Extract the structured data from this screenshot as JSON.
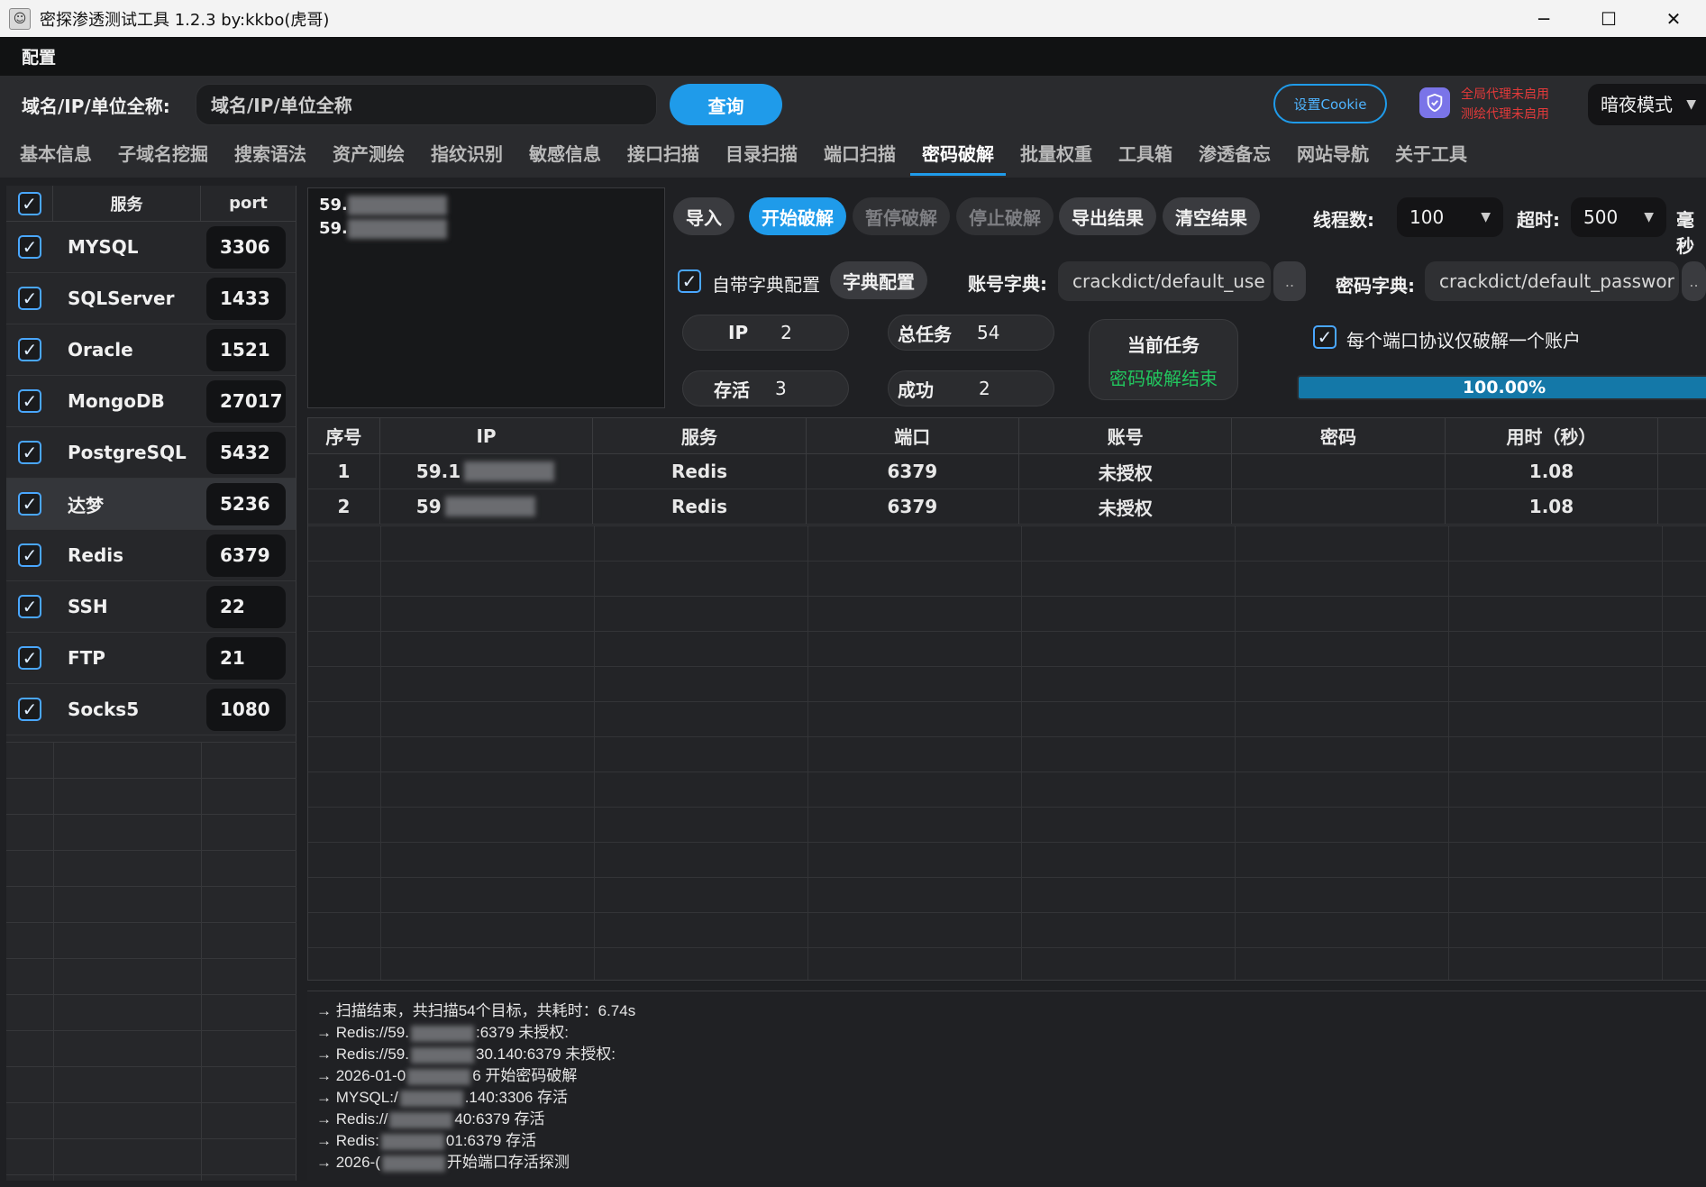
{
  "window": {
    "title": "密探渗透测试工具 1.2.3 by:kkbo(虎哥)",
    "minimize": "─",
    "maximize": "☐",
    "close": "✕"
  },
  "menu": {
    "config": "配置"
  },
  "search": {
    "label": "域名/IP/单位全称:",
    "placeholder": "域名/IP/单位全称",
    "query_button": "查询",
    "cookie_button": "设置Cookie",
    "proxy_global": "全局代理未启用",
    "proxy_test": "测绘代理未启用",
    "mode": "暗夜模式"
  },
  "tabs": [
    "基本信息",
    "子域名挖掘",
    "搜索语法",
    "资产测绘",
    "指纹识别",
    "敏感信息",
    "接口扫描",
    "目录扫描",
    "端口扫描",
    "密码破解",
    "批量权重",
    "工具箱",
    "渗透备忘",
    "网站导航",
    "关于工具"
  ],
  "active_tab": "密码破解",
  "services": {
    "header_service": "服务",
    "header_port": "port",
    "rows": [
      {
        "name": "MYSQL",
        "port": "3306"
      },
      {
        "name": "SQLServer",
        "port": "1433"
      },
      {
        "name": "Oracle",
        "port": "1521"
      },
      {
        "name": "MongoDB",
        "port": "27017"
      },
      {
        "name": "PostgreSQL",
        "port": "5432"
      },
      {
        "name": "达梦",
        "port": "5236"
      },
      {
        "name": "Redis",
        "port": "6379"
      },
      {
        "name": "SSH",
        "port": "22"
      },
      {
        "name": "FTP",
        "port": "21"
      },
      {
        "name": "Socks5",
        "port": "1080"
      }
    ]
  },
  "targets": [
    "59.",
    "59."
  ],
  "controls": {
    "import": "导入",
    "start": "开始破解",
    "pause": "暂停破解",
    "stop": "停止破解",
    "export": "导出结果",
    "clear": "清空结果",
    "threads_label": "线程数:",
    "threads_value": "100",
    "timeout_label": "超时:",
    "timeout_value": "500",
    "timeout_unit": "毫秒",
    "builtin_dict": "自带字典配置",
    "dict_config": "字典配置",
    "user_dict_label": "账号字典:",
    "user_dict_value": "crackdict/default_use",
    "pass_dict_label": "密码字典:",
    "pass_dict_value": "crackdict/default_passwor",
    "browse": "..",
    "one_per_port": "每个端口协议仅破解一个账户"
  },
  "stats": {
    "ip_label": "IP",
    "ip_value": "2",
    "total_label": "总任务",
    "total_value": "54",
    "alive_label": "存活",
    "alive_value": "3",
    "success_label": "成功",
    "success_value": "2",
    "current_task_label": "当前任务",
    "current_task_value": "密码破解结束",
    "progress_text": "100.00%",
    "progress": 1.0
  },
  "results": {
    "headers": [
      "序号",
      "IP",
      "服务",
      "端口",
      "账号",
      "密码",
      "用时（秒）"
    ],
    "rows": [
      {
        "no": "1",
        "ip": "59.1",
        "service": "Redis",
        "port": "6379",
        "account": "未授权",
        "password": "",
        "time": "1.08"
      },
      {
        "no": "2",
        "ip": "59",
        "service": "Redis",
        "port": "6379",
        "account": "未授权",
        "password": "",
        "time": "1.08"
      }
    ]
  },
  "log": [
    "→ 扫描结束，共扫描54个目标，共耗时：6.74s",
    "→ Redis://59.",
    "→ Redis://59.",
    "→ 2026-01-0",
    "→ MYSQL:/",
    "→ Redis://",
    "→ Redis:",
    "→ 2026-("
  ],
  "log_tail": [
    ":6379  未授权:",
    "30.140:6379  未授权:",
    "6 开始密码破解",
    ".140:3306  存活",
    "40:6379  存活",
    "01:6379  存活",
    "开始端口存活探测"
  ],
  "colors": {
    "accent": "#1f9bea",
    "success_text": "#22c55e",
    "proxy_warning": "#e23a3a"
  }
}
